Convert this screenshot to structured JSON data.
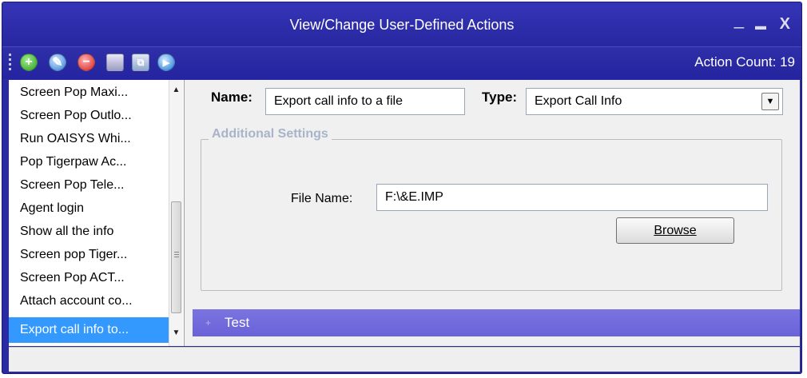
{
  "window": {
    "title": "View/Change User-Defined Actions",
    "minimize_glyph": "_",
    "maximize_glyph": "▬",
    "close_glyph": "X"
  },
  "toolbar": {
    "action_count": "Action Count: 19",
    "icons": [
      "add-icon",
      "edit-icon",
      "delete-icon",
      "save-icon",
      "copy-icon",
      "play-icon"
    ]
  },
  "actions_list": {
    "items": [
      "Screen Pop Maxi...",
      "Screen Pop Outlo...",
      "Run OAISYS Whi...",
      "Pop Tigerpaw Ac...",
      "Screen Pop Tele...",
      "Agent login",
      "Show all the info",
      "Screen pop Tiger...",
      "Screen Pop ACT...",
      "Attach account co...",
      "Export call info to..."
    ],
    "selected_index": 10
  },
  "form": {
    "name_label": "Name:",
    "name_value": "Export call info to a file",
    "type_label": "Type:",
    "type_value": "Export Call Info",
    "additional_settings_label": "Additional Settings",
    "file_name_label": "File Name:",
    "file_name_value": "F:\\&E.IMP",
    "browse_label": "Browse"
  },
  "test_panel": {
    "label": "Test"
  },
  "colors": {
    "window_frame": "#2a2aa4",
    "selection": "#3399ff",
    "test_bar": "#6f69dc"
  }
}
